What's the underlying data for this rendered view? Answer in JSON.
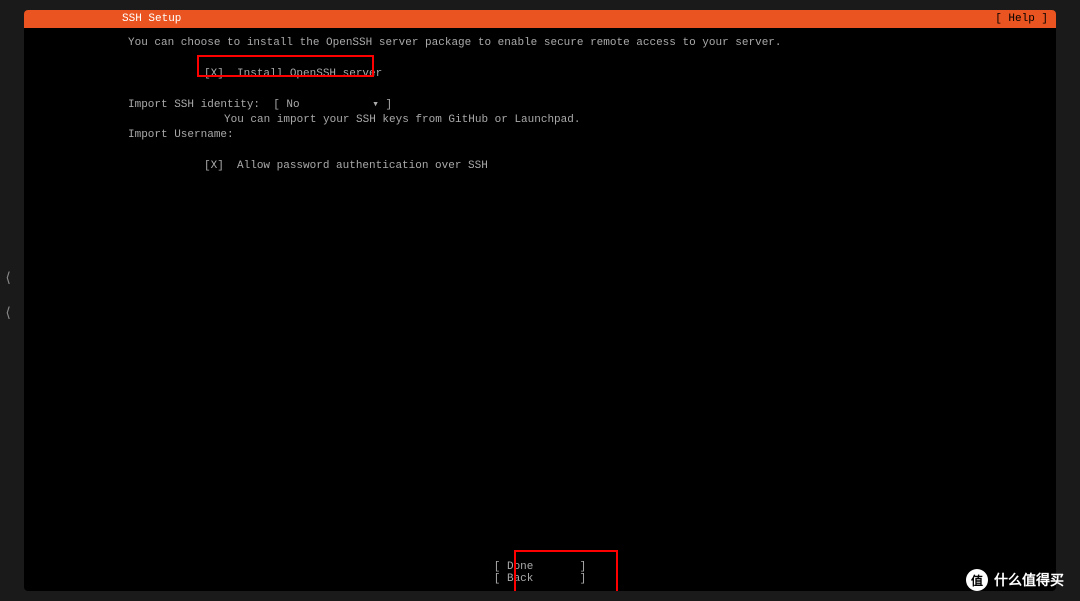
{
  "header": {
    "title": "SSH Setup",
    "help": "[ Help ]"
  },
  "intro": "You can choose to install the OpenSSH server package to enable secure remote access to your server.",
  "options": {
    "install_openssh": {
      "checkbox": "[X]",
      "label": "Install OpenSSH server"
    },
    "import_identity": {
      "label": "Import SSH identity:",
      "value": "[ No",
      "arrow": "▾ ]",
      "help": "You can import your SSH keys from GitHub or Launchpad."
    },
    "import_username": {
      "label": "Import Username:"
    },
    "allow_password": {
      "checkbox": "[X]",
      "label": "Allow password authentication over SSH"
    }
  },
  "buttons": {
    "done": "[ Done       ]",
    "back": "[ Back       ]"
  },
  "watermark": {
    "badge": "值",
    "text": "什么值得买"
  }
}
